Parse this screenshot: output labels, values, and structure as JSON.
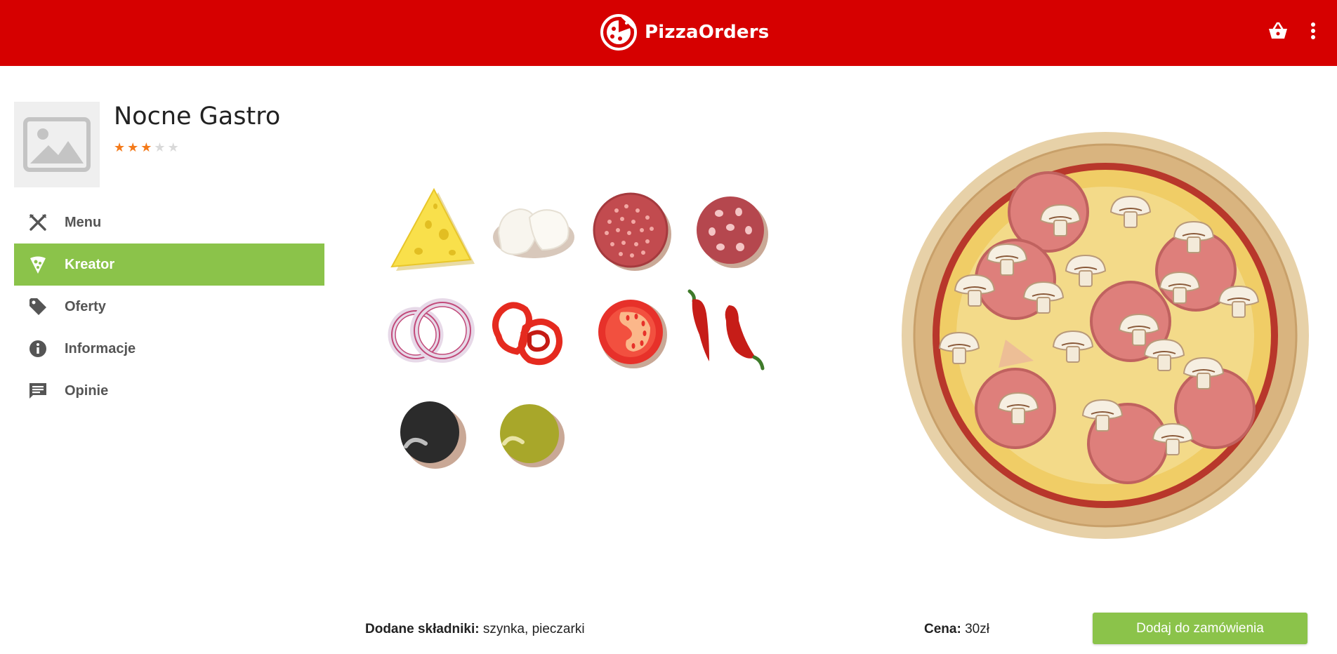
{
  "header": {
    "brand": "PizzaOrders",
    "bg_color": "#d60000",
    "cart_icon": "basket-icon",
    "menu_icon": "more-vertical-icon"
  },
  "restaurant": {
    "name": "Nocne Gastro",
    "rating": 3,
    "rating_max": 5,
    "thumbnail_icon": "image-placeholder-icon"
  },
  "nav": {
    "items": [
      {
        "label": "Menu",
        "icon": "fork-knife-icon",
        "active": false
      },
      {
        "label": "Kreator",
        "icon": "pizza-slice-icon",
        "active": true
      },
      {
        "label": "Oferty",
        "icon": "tag-icon",
        "active": false
      },
      {
        "label": "Informacje",
        "icon": "info-icon",
        "active": false
      },
      {
        "label": "Opinie",
        "icon": "comment-icon",
        "active": false
      }
    ],
    "active_color": "#8bc34a"
  },
  "ingredients": [
    "cheese-icon",
    "mozzarella-icon",
    "salami-icon",
    "pepperoni-icon",
    "onion-icon",
    "pepper-icon",
    "tomato-icon",
    "chili-icon",
    "black-olive-icon",
    "green-olive-icon"
  ],
  "footer": {
    "added_label": "Dodane składniki:",
    "added_value": "szynka, pieczarki",
    "price_label": "Cena:",
    "price_value": "30zł",
    "order_button": "Dodaj do zamówienia",
    "button_color": "#8bc34a"
  }
}
